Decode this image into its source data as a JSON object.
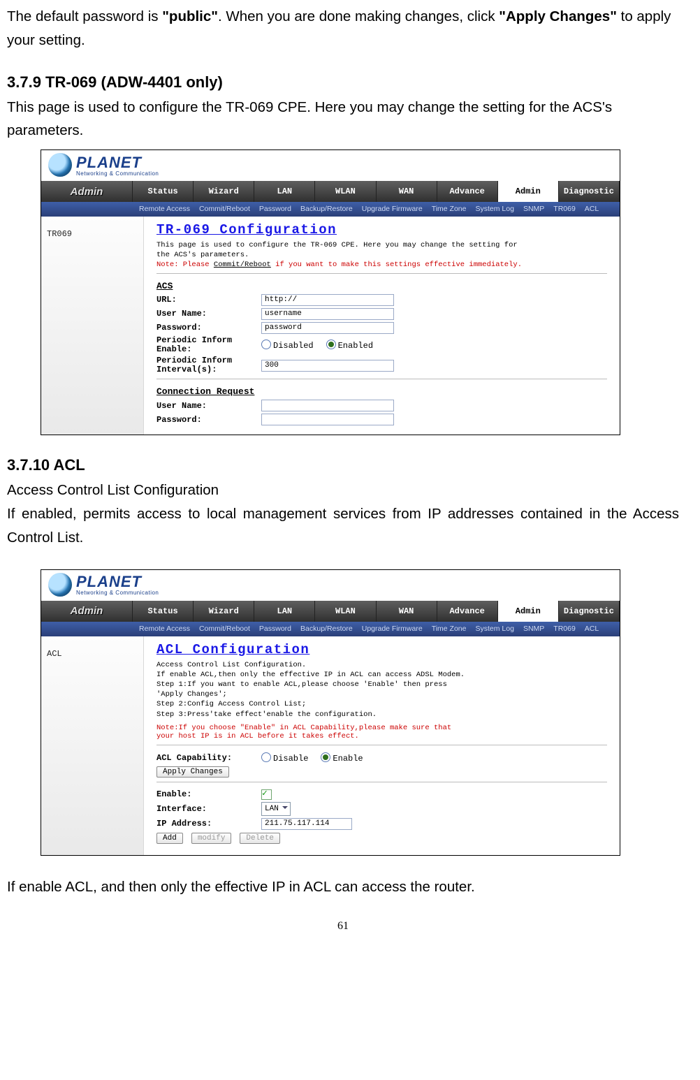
{
  "intro": {
    "pre": "The default password is ",
    "pw": "\"public\"",
    "mid": ". When you are done making changes, click ",
    "btn": "\"Apply Changes\"",
    "post": " to apply your setting."
  },
  "section379": {
    "heading": "3.7.9 TR-069 (ADW-4401 only)",
    "p": "This page is used to configure the TR-069 CPE. Here you may change the setting for the ACS's parameters."
  },
  "section3710": {
    "heading": "3.7.10 ACL",
    "p1": "Access Control List Configuration",
    "p2": "If enabled, permits access to local management services from IP addresses contained in the Access Control List.",
    "p3": "If enable ACL, and then only the effective IP in ACL can access the router."
  },
  "logo": {
    "brand": "PLANET",
    "sub": "Networking & Communication"
  },
  "topnav_left": "Admin",
  "topnav": [
    "Status",
    "Wizard",
    "LAN",
    "WLAN",
    "WAN",
    "Advance",
    "Admin",
    "Diagnostic"
  ],
  "subnav": [
    "Remote Access",
    "Commit/Reboot",
    "Password",
    "Backup/Restore",
    "Upgrade Firmware",
    "Time Zone",
    "System Log",
    "SNMP",
    "TR069",
    "ACL"
  ],
  "ss1": {
    "sidebar": "TR069",
    "title": "TR-069 Configuration",
    "desc1": "This page is used to configure the TR-069 CPE. Here you may change the setting for",
    "desc2": "the ACS's parameters.",
    "note_pre": "Note: Please ",
    "note_link": "Commit/Reboot",
    "note_post": " if you want to make this settings effective immediately.",
    "grp1": "ACS",
    "url_label": "URL:",
    "url_val": "http://",
    "user_label": "User Name:",
    "user_val": "username",
    "pass_label": "Password:",
    "pass_val": "password",
    "pie_label": "Periodic Inform Enable:",
    "pie_opt1": "Disabled",
    "pie_opt2": "Enabled",
    "pii_label": "Periodic Inform Interval(s):",
    "pii_val": "300",
    "grp2": "Connection Request",
    "cr_user_label": "User Name:",
    "cr_pass_label": "Password:"
  },
  "ss2": {
    "sidebar": "ACL",
    "title": "ACL Configuration",
    "d1": "Access Control List Configuration.",
    "d2": "If enable ACL,then only the effective IP in ACL can access ADSL Modem.",
    "d3": "Step 1:If you want to enable ACL,please choose 'Enable' then press",
    "d4": "'Apply Changes';",
    "d5": "Step 2:Config Access Control List;",
    "d6": "Step 3:Press'take effect'enable the configuration.",
    "n1": "Note:If you choose \"Enable\" in ACL Capability,please make sure that",
    "n2": "your host IP is in ACL before it takes effect.",
    "cap_label": "ACL Capability:",
    "cap_opt1": "Disable",
    "cap_opt2": "Enable",
    "apply": "Apply Changes",
    "en_label": "Enable:",
    "if_label": "Interface:",
    "if_val": "LAN",
    "ip_label": "IP Address:",
    "ip_val": "211.75.117.114",
    "b_add": "Add",
    "b_mod": "modify",
    "b_del": "Delete"
  },
  "page_num": "61"
}
